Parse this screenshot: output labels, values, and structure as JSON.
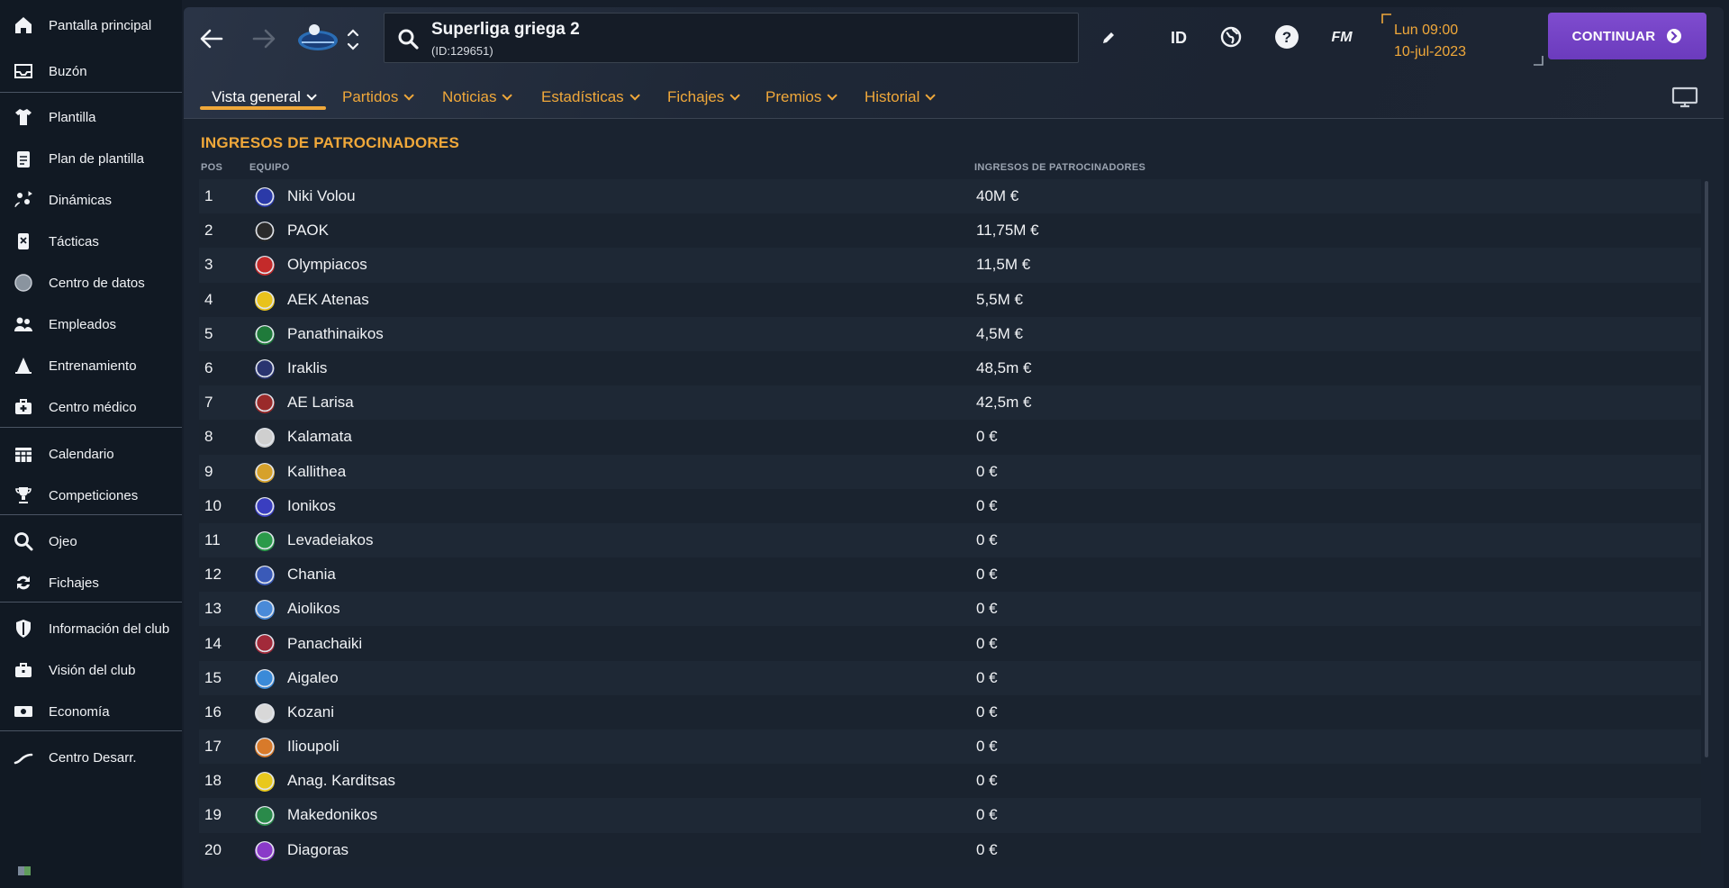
{
  "sidebar": {
    "items": [
      {
        "label": "Pantalla principal",
        "icon": "home-icon"
      },
      {
        "label": "Buzón",
        "icon": "inbox-icon"
      },
      {
        "label": "Plantilla",
        "icon": "shirt-icon"
      },
      {
        "label": "Plan de plantilla",
        "icon": "clipboard-icon"
      },
      {
        "label": "Dinámicas",
        "icon": "people-swap-icon"
      },
      {
        "label": "Tácticas",
        "icon": "tactics-board-icon"
      },
      {
        "label": "Centro de datos",
        "icon": "data-sphere-icon"
      },
      {
        "label": "Empleados",
        "icon": "staff-icon"
      },
      {
        "label": "Entrenamiento",
        "icon": "cone-icon"
      },
      {
        "label": "Centro médico",
        "icon": "medical-kit-icon"
      },
      {
        "label": "Calendario",
        "icon": "calendar-icon"
      },
      {
        "label": "Competiciones",
        "icon": "trophy-icon"
      },
      {
        "label": "Ojeo",
        "icon": "magnifier-icon"
      },
      {
        "label": "Fichajes",
        "icon": "transfer-icon"
      },
      {
        "label": "Información del club",
        "icon": "shield-icon"
      },
      {
        "label": "Visión del club",
        "icon": "briefcase-icon"
      },
      {
        "label": "Economía",
        "icon": "money-icon"
      },
      {
        "label": "Centro Desarr.",
        "icon": "growth-icon"
      }
    ]
  },
  "header": {
    "search_title": "Superliga griega 2",
    "search_sub": "(ID:129651)",
    "id_label": "ID",
    "fm_label": "FM",
    "date_line1": "Lun 09:00",
    "date_line2": "10-jul-2023",
    "continue_label": "CONTINUAR"
  },
  "tabs": [
    {
      "label": "Vista general",
      "active": true
    },
    {
      "label": "Partidos",
      "active": false
    },
    {
      "label": "Noticias",
      "active": false
    },
    {
      "label": "Estadísticas",
      "active": false
    },
    {
      "label": "Fichajes",
      "active": false
    },
    {
      "label": "Premios",
      "active": false
    },
    {
      "label": "Historial",
      "active": false
    }
  ],
  "table": {
    "title": "INGRESOS DE PATROCINADORES",
    "col_pos": "POS",
    "col_team": "EQUIPO",
    "col_income": "INGRESOS DE PATROCINADORES",
    "rows": [
      {
        "pos": "1",
        "team": "Niki Volou",
        "income": "40M €",
        "crest": "#2b3aa8"
      },
      {
        "pos": "2",
        "team": "PAOK",
        "income": "11,75M €",
        "crest": "#2a2a2a"
      },
      {
        "pos": "3",
        "team": "Olympiacos",
        "income": "11,5M €",
        "crest": "#c42a2a"
      },
      {
        "pos": "4",
        "team": "AEK Atenas",
        "income": "5,5M €",
        "crest": "#e8c21c"
      },
      {
        "pos": "5",
        "team": "Panathinaikos",
        "income": "4,5M €",
        "crest": "#1f7a3a"
      },
      {
        "pos": "6",
        "team": "Iraklis",
        "income": "48,5m €",
        "crest": "#2a3470"
      },
      {
        "pos": "7",
        "team": "AE Larisa",
        "income": "42,5m €",
        "crest": "#9a2a2a"
      },
      {
        "pos": "8",
        "team": "Kalamata",
        "income": "0 €",
        "crest": "#cfcfcf"
      },
      {
        "pos": "9",
        "team": "Kallithea",
        "income": "0 €",
        "crest": "#d6a12a"
      },
      {
        "pos": "10",
        "team": "Ionikos",
        "income": "0 €",
        "crest": "#3a3ec0"
      },
      {
        "pos": "11",
        "team": "Levadeiakos",
        "income": "0 €",
        "crest": "#2a9a4a"
      },
      {
        "pos": "12",
        "team": "Chania",
        "income": "0 €",
        "crest": "#3a5ab8"
      },
      {
        "pos": "13",
        "team": "Aiolikos",
        "income": "0 €",
        "crest": "#4a8ad8"
      },
      {
        "pos": "14",
        "team": "Panachaiki",
        "income": "0 €",
        "crest": "#a22a3a"
      },
      {
        "pos": "15",
        "team": "Aigaleo",
        "income": "0 €",
        "crest": "#3a8ad8"
      },
      {
        "pos": "16",
        "team": "Kozani",
        "income": "0 €",
        "crest": "#d8d8d8"
      },
      {
        "pos": "17",
        "team": "Ilioupoli",
        "income": "0 €",
        "crest": "#d87a2a"
      },
      {
        "pos": "18",
        "team": "Anag. Karditsas",
        "income": "0 €",
        "crest": "#e8c81c"
      },
      {
        "pos": "19",
        "team": "Makedonikos",
        "income": "0 €",
        "crest": "#2a8a4a"
      },
      {
        "pos": "20",
        "team": "Diagoras",
        "income": "0 €",
        "crest": "#8a3ac8"
      }
    ]
  },
  "colors": {
    "accent": "#f0a83a",
    "continue": "#7a45c9",
    "sidebar": "#111923",
    "main": "#1a2330"
  }
}
